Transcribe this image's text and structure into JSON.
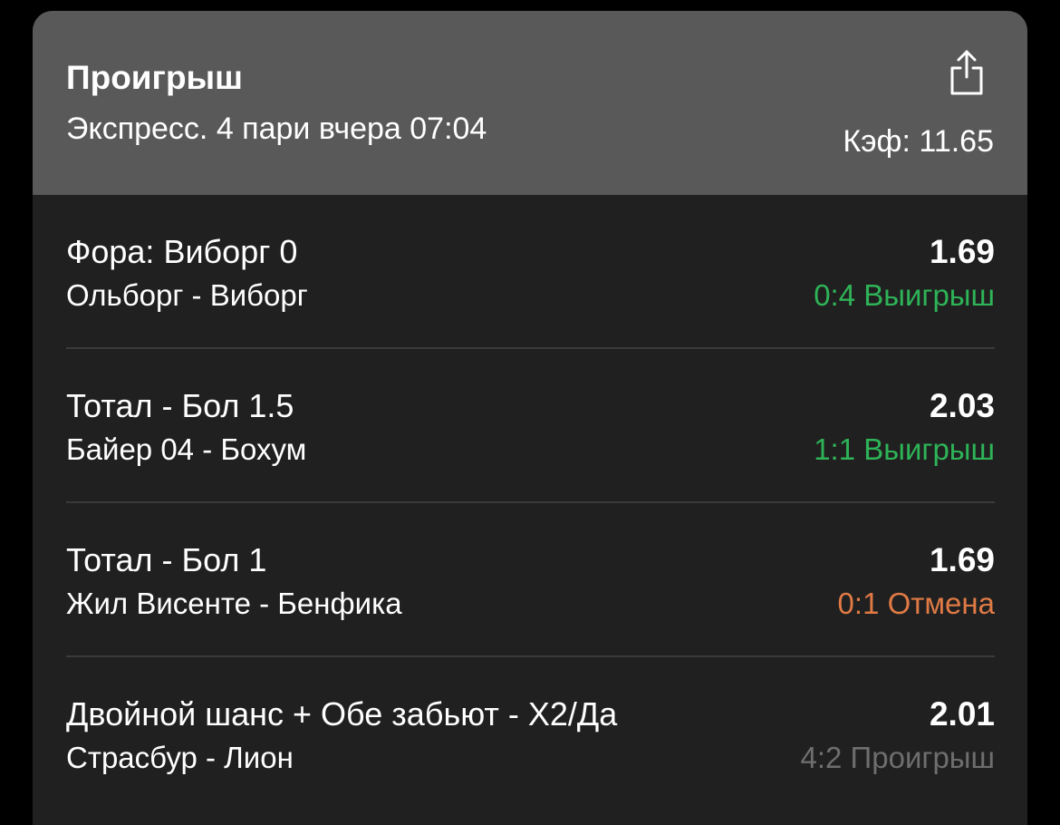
{
  "header": {
    "status": "Проигрыш",
    "subtitle": "Экспресс. 4 пари вчера 07:04",
    "total_odds": "Кэф: 11.65",
    "share_icon": "share-icon"
  },
  "colors": {
    "win": "#2eb357",
    "cancel": "#e07a45",
    "loss": "#6e6e6e"
  },
  "bets": [
    {
      "market": "Фора: Виборг 0",
      "match": "Ольборг - Виборг",
      "odds": "1.69",
      "result": "0:4 Выигрыш",
      "result_color": "#2eb357"
    },
    {
      "market": "Тотал - Бол 1.5",
      "match": "Байер 04 - Бохум",
      "odds": "2.03",
      "result": "1:1 Выигрыш",
      "result_color": "#2eb357"
    },
    {
      "market": "Тотал - Бол 1",
      "match": "Жил Висенте - Бенфика",
      "odds": "1.69",
      "result": "0:1 Отмена",
      "result_color": "#e07a45"
    },
    {
      "market": "Двойной шанс + Обе забьют - Х2/Да",
      "match": "Страсбур - Лион",
      "odds": "2.01",
      "result": "4:2 Проигрыш",
      "result_color": "#6e6e6e"
    }
  ]
}
